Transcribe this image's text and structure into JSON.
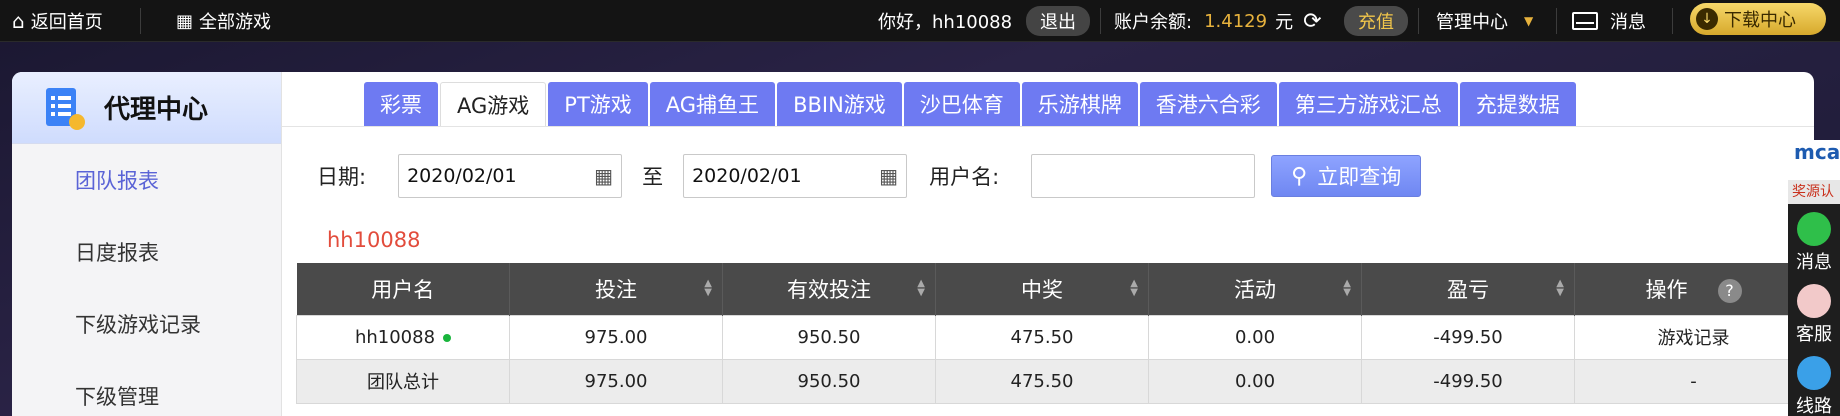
{
  "topbar": {
    "home": "返回首页",
    "all_games": "全部游戏",
    "greeting": "你好，hh10088",
    "logout": "退出",
    "balance_label": "账户余额:",
    "balance_value": "1.4129",
    "balance_unit": "元",
    "recharge": "充值",
    "manage": "管理中心",
    "messages": "消息",
    "download": "下载中心"
  },
  "sidebar": {
    "title": "代理中心",
    "items": [
      {
        "label": "团队报表"
      },
      {
        "label": "日度报表"
      },
      {
        "label": "下级游戏记录"
      },
      {
        "label": "下级管理"
      }
    ]
  },
  "tabs": [
    {
      "label": "彩票"
    },
    {
      "label": "AG游戏"
    },
    {
      "label": "PT游戏"
    },
    {
      "label": "AG捕鱼王"
    },
    {
      "label": "BBIN游戏"
    },
    {
      "label": "沙巴体育"
    },
    {
      "label": "乐游棋牌"
    },
    {
      "label": "香港六合彩"
    },
    {
      "label": "第三方游戏汇总"
    },
    {
      "label": "充提数据"
    }
  ],
  "filter": {
    "date_label": "日期:",
    "date_from": "2020/02/01",
    "to_label": "至",
    "date_to": "2020/02/01",
    "user_label": "用户名:",
    "user_value": "",
    "query_button": "立即查询"
  },
  "account_label": "hh10088",
  "table": {
    "headers": [
      "用户名",
      "投注",
      "有效投注",
      "中奖",
      "活动",
      "盈亏",
      "操作"
    ],
    "help": "?",
    "rows": [
      [
        "hh10088",
        "975.00",
        "950.50",
        "475.50",
        "0.00",
        "-499.50",
        "游戏记录"
      ],
      [
        "团队总计",
        "975.00",
        "950.50",
        "475.50",
        "0.00",
        "-499.50",
        "-"
      ]
    ]
  },
  "float_bar": {
    "logo": "mca",
    "tag": "奖源认",
    "items": [
      {
        "label": "消息"
      },
      {
        "label": "客服"
      },
      {
        "label": "线路"
      }
    ]
  },
  "colors": {
    "tab_blue": "#6e7af2",
    "active_side": "#5a63d6",
    "gold": "#e7b23d",
    "account_red": "#e24c3c"
  }
}
